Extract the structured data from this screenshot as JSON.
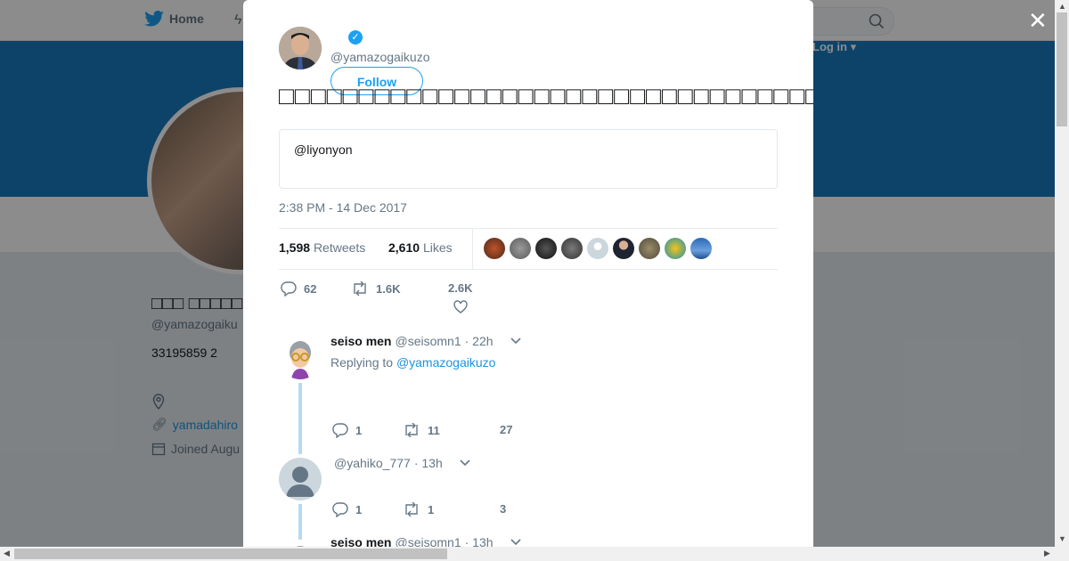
{
  "nav": {
    "home_label": "Home",
    "login_label": "Log in ▾"
  },
  "profile": {
    "name": "□□□ □□□□□",
    "handle": "@yamazogaiku",
    "bio": "33195859 2",
    "link": "yamadahiro",
    "joined": "Joined Augu"
  },
  "tweet": {
    "handle": "@yamazogaikuzo",
    "follow_label": "Follow",
    "text": "□□□□□□□□□□□□□□□□□□□□□□□□□□□□□□□□□□□□□□□□□□□□□□",
    "quote": "@liyonyon",
    "timestamp": "2:38 PM - 14 Dec 2017",
    "retweets_count": "1,598",
    "retweets_label": "Retweets",
    "likes_count": "2,610",
    "likes_label": "Likes",
    "actions": {
      "replies": "62",
      "retweets": "1.6K",
      "likes": "2.6K"
    }
  },
  "replies": [
    {
      "name": "seiso men",
      "handle": "@seisomn1",
      "time": "· 22h",
      "replying_prefix": "Replying to",
      "replying_to": "@yamazogaikuzo",
      "replies": "1",
      "retweets": "11",
      "likes": "27"
    },
    {
      "name": "",
      "handle": "@yahiko_777",
      "time": "· 13h",
      "replies": "1",
      "retweets": "1",
      "likes": "3"
    },
    {
      "name": "seiso men",
      "handle": "@seisomn1",
      "time": "· 13h"
    }
  ],
  "colors": {
    "accent": "#1da1f2",
    "banner": "#1b7ac0",
    "link": "#1b95e0"
  }
}
